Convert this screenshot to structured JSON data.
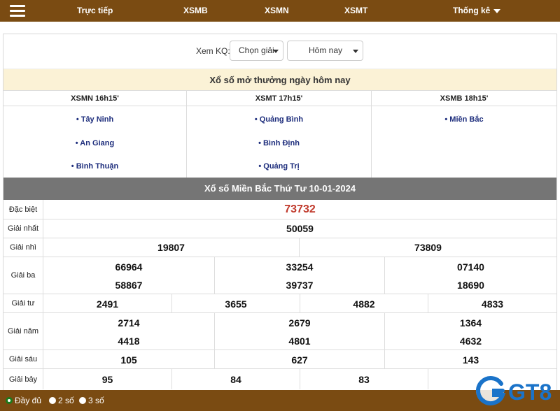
{
  "nav": {
    "items": [
      {
        "label": "Trực tiếp"
      },
      {
        "label": "XSMB"
      },
      {
        "label": "XSMN"
      },
      {
        "label": "XSMT"
      },
      {
        "label": "Thống kê"
      }
    ],
    "menu_icon": "hamburger-menu-icon",
    "bg_color": "#7a4b12"
  },
  "filter": {
    "label": "Xem KQ:",
    "prize_select": "Chọn giải",
    "date_select": "Hôm nay"
  },
  "banner": "Xổ số mở thưởng ngày hôm nay",
  "regions": [
    {
      "header": "XSMN 16h15'",
      "links": [
        "• Tây Ninh",
        "• An Giang",
        "• Bình Thuận"
      ]
    },
    {
      "header": "XSMT 17h15'",
      "links": [
        "• Quảng Bình",
        "• Bình Định",
        "• Quảng Trị"
      ]
    },
    {
      "header": "XSMB 18h15'",
      "links": [
        "• Miền Bắc"
      ]
    }
  ],
  "results": {
    "title": "Xổ số Miền Bắc Thứ Tư 10-01-2024",
    "rows": [
      {
        "label": "Đặc biệt",
        "numbers": [
          "73732"
        ]
      },
      {
        "label": "Giải nhất",
        "numbers": [
          "50059"
        ]
      },
      {
        "label": "Giải nhì",
        "numbers": [
          "19807",
          "73809"
        ]
      },
      {
        "label": "Giải ba",
        "numbers": [
          "66964",
          "33254",
          "07140",
          "58867",
          "39737",
          "18690"
        ]
      },
      {
        "label": "Giải tư",
        "numbers": [
          "2491",
          "3655",
          "4882",
          "4833"
        ]
      },
      {
        "label": "Giải năm",
        "numbers": [
          "2714",
          "2679",
          "1364",
          "4418",
          "4801",
          "4632"
        ]
      },
      {
        "label": "Giải sáu",
        "numbers": [
          "105",
          "627",
          "143"
        ]
      },
      {
        "label": "Giải bảy",
        "numbers": [
          "95",
          "84",
          "83",
          ""
        ]
      }
    ],
    "special_color": "#c0392b"
  },
  "bottom": {
    "options": [
      "Đầy đủ",
      "2 số",
      "3 số"
    ],
    "selected": "Đầy đủ"
  },
  "watermark": {
    "text": "GT8",
    "color": "#1a73c9"
  }
}
